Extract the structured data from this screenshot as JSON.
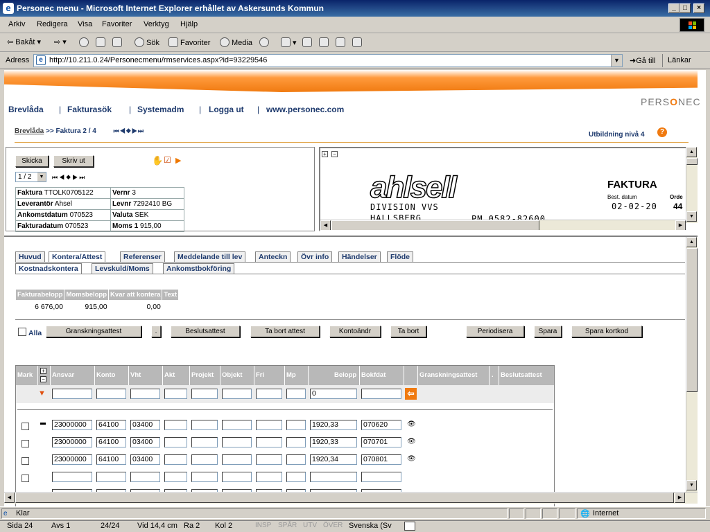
{
  "window": {
    "title": "Personec menu - Microsoft Internet Explorer erhållet av Askersunds Kommun"
  },
  "menu": [
    "Arkiv",
    "Redigera",
    "Visa",
    "Favoriter",
    "Verktyg",
    "Hjälp"
  ],
  "toolbar": {
    "back": "Bakåt",
    "search": "Sök",
    "favorites": "Favoriter",
    "media": "Media"
  },
  "address": {
    "label": "Adress",
    "url": "http://10.211.0.24/Personecmenu/rmservices.aspx?id=93229546",
    "go": "Gå till",
    "links": "Länkar"
  },
  "nav": {
    "items": [
      "Brevlåda",
      "Fakturasök",
      "Systemadm",
      "Logga ut",
      "www.personec.com"
    ],
    "logo_a": "PERS",
    "logo_o": "O",
    "logo_b": "NEC"
  },
  "breadcrumb": {
    "link": "Brevlåda",
    "sep": ">>",
    "current": "Faktura 2 / 4"
  },
  "level": "Utbildning nivå 4",
  "help": "?",
  "leftpanel": {
    "send": "Skicka",
    "print": "Skriv ut",
    "page": "1 / 2",
    "info": [
      [
        "Faktura",
        "TTOLK0705122",
        "Vernr",
        "3"
      ],
      [
        "Leverantör",
        "Ahsel",
        "Levnr",
        "7292410 BG"
      ],
      [
        "Ankomstdatum",
        "070523",
        "Valuta",
        "SEK"
      ],
      [
        "Fakturadatum",
        "070523",
        "Moms 1",
        "915,00"
      ]
    ]
  },
  "invoice_image": {
    "brand": "ahlsell",
    "division": "DIVISION VVS",
    "city": "HALLSBERG",
    "pm": "PM 0582-82600",
    "doc_title": "FAKTURA",
    "best_label": "Best. datum",
    "best_date": "02-02-20",
    "order_label": "Orde",
    "order_num": "44"
  },
  "tabs_row1": [
    "Huvud",
    "Kontera/Attest",
    "Referenser",
    "Meddelande till lev",
    "Anteckn",
    "Övr info",
    "Händelser",
    "Flöde"
  ],
  "tabs_row2": [
    "Kostnadskontera",
    "Levskuld/Moms",
    "Ankomstbokföring"
  ],
  "summary": {
    "headers": [
      "Fakturabelopp",
      "Momsbelopp",
      "Kvar att kontera",
      "Text"
    ],
    "values": [
      "6 676,00",
      "915,00",
      "0,00",
      ""
    ]
  },
  "actions": {
    "all": "Alla",
    "review": "Granskningsattest",
    "dot": ".",
    "decision": "Beslutsattest",
    "remove_attest": "Ta bort attest",
    "account_change": "Kontoändr",
    "remove": "Ta bort",
    "periodize": "Periodisera",
    "save": "Spara",
    "save_code": "Spara kortkod"
  },
  "grid": {
    "headers": [
      "Mark",
      "Ansvar",
      "Konto",
      "Vht",
      "Akt",
      "Projekt",
      "Objekt",
      "Fri",
      "Mp",
      "Belopp",
      "Bokfdat",
      "Granskningsattest",
      ".",
      "Beslutsattest"
    ],
    "filter_belopp": "0",
    "rows": [
      {
        "ansvar": "23000000",
        "konto": "64100",
        "vht": "03400",
        "belopp": "1920,33",
        "bokfdat": "070620"
      },
      {
        "ansvar": "23000000",
        "konto": "64100",
        "vht": "03400",
        "belopp": "1920,33",
        "bokfdat": "070701"
      },
      {
        "ansvar": "23000000",
        "konto": "64100",
        "vht": "03400",
        "belopp": "1920,34",
        "bokfdat": "070801"
      }
    ]
  },
  "status": {
    "text": "Klar",
    "zone": "Internet"
  },
  "word_status": {
    "page": "Sida 24",
    "section": "Avs 1",
    "pages": "24/24",
    "pos": "Vid 14,4 cm",
    "line": "Ra 2",
    "col": "Kol 2",
    "rec": "INSP",
    "trk": "SPÅR",
    "ext": "UTV",
    "ovr": "ÖVER",
    "lang": "Svenska (Sv"
  }
}
